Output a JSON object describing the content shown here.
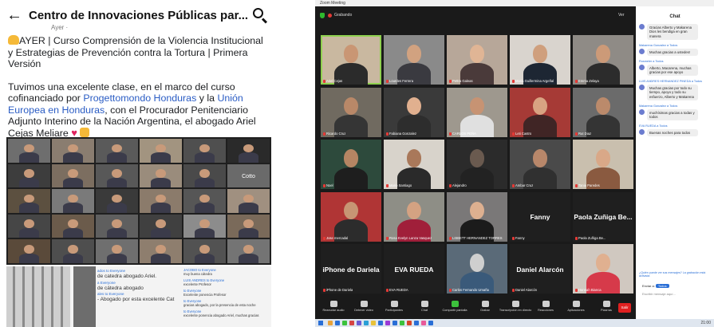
{
  "facebook": {
    "page_title": "Centro de Innovaciones Públicas par...",
    "post_meta": "Ayer · ",
    "post_line1": "AYER | Curso Comprensión de la Violencia Institucional y Estrategias de Prevención contra la Tortura | Primera Versión",
    "post_p2_a": "Tuvimos una excelente clase, en el marco del curso cofinanciado por ",
    "post_link1": "Progettomondo Honduras",
    "post_p2_b": " y la ",
    "post_link2": "Unión Europea en Honduras",
    "post_p2_c": ", con el Procurador Penitenciario Adjunto Interino de la Nación Argentina, el abogado Ariel Cejas Meliare ",
    "mini_grid_center": "Cotto",
    "chat_lines": [
      {
        "who": "ados to Everyone",
        "text": "de catedra abogado Ariel."
      },
      {
        "who": "a Everyone",
        "text": "de cátedra abogado"
      },
      {
        "who": "ales to Everyone",
        "text": "- Abogado por esta excelente Cat"
      }
    ],
    "chat_right": [
      {
        "who": "JACOBO to Everyone",
        "text": "muy buena cátedra"
      },
      {
        "who": "LUIS ANDRES to Everyone",
        "text": "excelente Profesor"
      },
      {
        "who": "to Everyone",
        "text": "Excelente ponencia Profesor"
      },
      {
        "who": "to Everyone",
        "text": "gracias abogado, por la presencia de esta noche"
      },
      {
        "who": "to Everyone",
        "text": "excelente ponencia abogado Ariel, muchas gracias"
      }
    ]
  },
  "zoom": {
    "window_title": "Zoom Meeting",
    "rec_label": "Grabando",
    "view_label": "Ver",
    "tiles": [
      {
        "name": "Ariel Cejas",
        "type": "person",
        "bg": "#c9b8a0",
        "skin": "#c99674",
        "shirt": "#2b2b2b",
        "active": true
      },
      {
        "name": "Lourdes Ferrera",
        "type": "person",
        "bg": "#8a8a8a",
        "skin": "#d1a280",
        "shirt": "#3a3a40"
      },
      {
        "name": "Pettra Galeas",
        "type": "person",
        "bg": "#b7a799",
        "skin": "#e0b595",
        "shirt": "#4a3a3a"
      },
      {
        "name": "Maria Guillermina Argeñal",
        "type": "person",
        "bg": "#d9d4ce",
        "skin": "#cf9f7d",
        "shirt": "#1d2633"
      },
      {
        "name": "Emma Zelaya",
        "type": "person",
        "bg": "#8f8b86",
        "skin": "#cc9a78",
        "shirt": "#2c2c2c"
      },
      {
        "name": "Ricardo Cruz",
        "type": "person",
        "bg": "#706a60",
        "skin": "#b98868",
        "shirt": "#353535"
      },
      {
        "name": "Fabiana Gonzalez",
        "type": "person",
        "bg": "#3a3a3a",
        "skin": "#e1b08f",
        "shirt": "#2d2d2d"
      },
      {
        "name": "CARLOS PEÑA",
        "type": "person",
        "bg": "#9e988e",
        "skin": "#c79373",
        "shirt": "#e0e0e0"
      },
      {
        "name": "Leti Castro",
        "type": "person",
        "bg": "#a63a36",
        "skin": "#d8a382",
        "shirt": "#402525"
      },
      {
        "name": "Rut Diaz",
        "type": "person",
        "bg": "#6b6b6b",
        "skin": "#bb8a6b",
        "shirt": "#343434"
      },
      {
        "name": "Noel",
        "type": "person",
        "bg": "#2d4a3c",
        "skin": "#b58563",
        "shirt": "#1e1e1e"
      },
      {
        "name": "Mario Santiago",
        "type": "person",
        "bg": "#d8d3cb",
        "skin": "#a9785a",
        "shirt": "#2a2a2a"
      },
      {
        "name": "Alejandro",
        "type": "person",
        "bg": "#2b2b2b",
        "skin": "#6a5a4f",
        "shirt": "#222222"
      },
      {
        "name": "Ambar Cruz",
        "type": "person",
        "bg": "#4a4a4a",
        "skin": "#b8876a",
        "shirt": "#303030"
      },
      {
        "name": "Tania Paredes",
        "type": "person",
        "bg": "#c9bfae",
        "skin": "#d9a888",
        "shirt": "#8a5a40"
      },
      {
        "name": "Jose mercadal",
        "type": "person",
        "bg": "#b03535",
        "skin": "#c79574",
        "shirt": "#2c2c2c"
      },
      {
        "name": "Rosa Evelyn Lanza Vasquez",
        "type": "person",
        "bg": "#8e8e86",
        "skin": "#d4a282",
        "shirt": "#a01f3a"
      },
      {
        "name": "LISBETT HERNANDEZ TORRES",
        "type": "person",
        "bg": "#7a7878",
        "skin": "#ddb090",
        "shirt": "#1b1b1b"
      },
      {
        "name": "Fanny",
        "type": "name",
        "bg": "#1f1f1f"
      },
      {
        "name": "Paola Zuñiga Be...",
        "type": "name",
        "bg": "#1f1f1f"
      },
      {
        "name": "iPhone de Dariela",
        "type": "name",
        "bg": "#1f1f1f"
      },
      {
        "name": "EVA RUEDA",
        "type": "name",
        "bg": "#1f1f1f"
      },
      {
        "name": "Carlos Fernando Umaña",
        "type": "person",
        "bg": "#5a6a78",
        "skin": "#cfcfcf",
        "shirt": "#3a5a7a"
      },
      {
        "name": "Daniel Alarcón",
        "type": "name",
        "bg": "#1f1f1f"
      },
      {
        "name": "Hannah Bianca",
        "type": "person",
        "bg": "#d0c8c0",
        "skin": "#e0b090",
        "shirt": "#d63a4a"
      }
    ],
    "toolbar": [
      {
        "label": "Reanudar audio",
        "color": "#d0d0d0"
      },
      {
        "label": "Detener video",
        "color": "#d0d0d0"
      },
      {
        "label": "Participantes",
        "color": "#d0d0d0"
      },
      {
        "label": "Chat",
        "color": "#d0d0d0"
      },
      {
        "label": "Compartir pantalla",
        "color": "#3cc23c"
      },
      {
        "label": "Grabar",
        "color": "#d0d0d0"
      },
      {
        "label": "Transcripción en directo",
        "color": "#d0d0d0"
      },
      {
        "label": "Reacciones",
        "color": "#d0d0d0"
      },
      {
        "label": "Aplicaciones",
        "color": "#d0d0d0"
      },
      {
        "label": "Pizarras",
        "color": "#d0d0d0"
      }
    ],
    "end_label": "Salir",
    "chat": {
      "title": "Chat",
      "messages": [
        {
          "from": "",
          "text": "Gracias Alberto y Makarena Dios les bendiga en gran manera"
        },
        {
          "from": "Makarena Gonzalez a Todos",
          "text": "Muchas gracias a ustedes!"
        },
        {
          "from": "Rosmeler a Todos",
          "text": "Alberto, Macarena, muchas gracias por ese apoyo"
        },
        {
          "from": "LUIS ANDRES HERNANDEZ PINEDA a Todos",
          "text": "Muchas gracias por todo su tiempo, apoyo y todo su esfuerzo, Alberto y Makarena"
        },
        {
          "from": "Makarena Gonzalez a Todos",
          "text": "muchísimas gracias a todas y todos"
        },
        {
          "from": "EVA RUEDA a Todos",
          "text": "Buenas noches para todos"
        }
      ],
      "hint": "¿Quién puede ver sus mensajes? La grabación está activada",
      "to_label": "Enviar a:",
      "to_value": "Todos",
      "input_placeholder": "Escribir mensaje aquí..."
    },
    "taskbar_clock": "21:00"
  }
}
